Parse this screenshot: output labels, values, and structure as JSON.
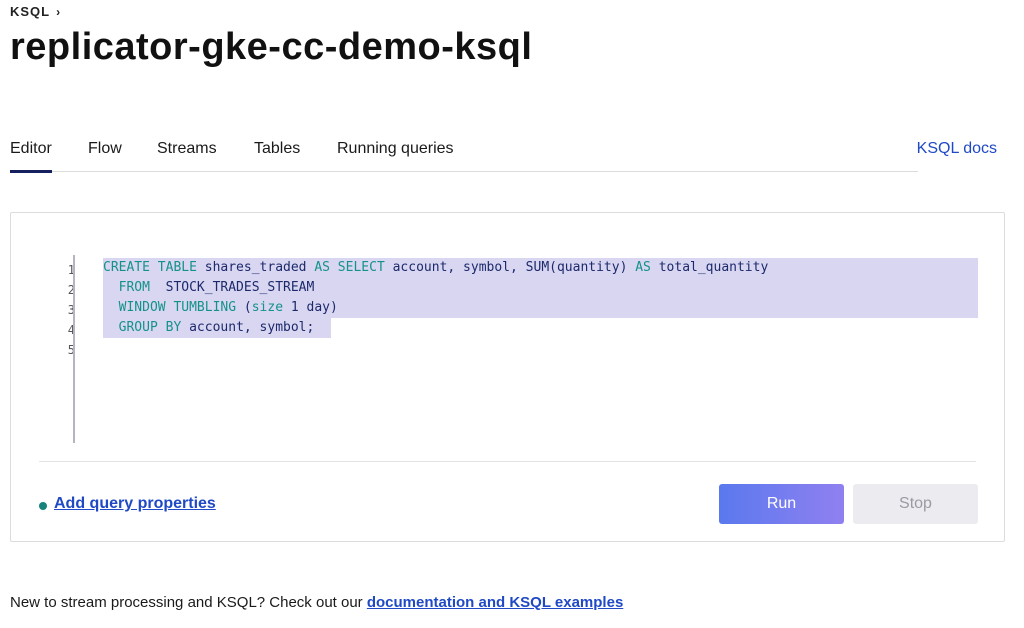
{
  "breadcrumb": {
    "label": "KSQL",
    "chevron": "›"
  },
  "title": "replicator-gke-cc-demo-ksql",
  "tabs": [
    {
      "label": "Editor",
      "active": true
    },
    {
      "label": "Flow",
      "active": false
    },
    {
      "label": "Streams",
      "active": false
    },
    {
      "label": "Tables",
      "active": false
    },
    {
      "label": "Running queries",
      "active": false
    }
  ],
  "docs_link": "KSQL docs",
  "editor": {
    "line_numbers": [
      "1",
      "2",
      "3",
      "4",
      "5"
    ],
    "lines": [
      [
        "kw:CREATE TABLE",
        "tx: shares_traded ",
        "kw:AS SELECT",
        "tx: account, symbol, SUM(quantity) ",
        "kw:AS",
        "tx: total_quantity"
      ],
      [
        "tx:  ",
        "kw:FROM",
        "tx:  STOCK_TRADES_STREAM"
      ],
      [
        "tx:  ",
        "kw:WINDOW TUMBLING",
        "tx: (",
        "kw:size",
        "tx: 1 day)"
      ],
      [
        "tx:  ",
        "kw:GROUP BY",
        "tx: account, symbol;"
      ],
      []
    ]
  },
  "add_properties_link": "Add query properties",
  "run_button": "Run",
  "stop_button": "Stop",
  "footer": {
    "text": "New to stream processing and KSQL? Check out our ",
    "link": "documentation and KSQL examples"
  },
  "colors": {
    "accent": "#1f49c5",
    "tab_indicator": "#17205e",
    "keyword": "#14928a",
    "selection": "#d9d6f1",
    "status_dot": "#16827a"
  }
}
